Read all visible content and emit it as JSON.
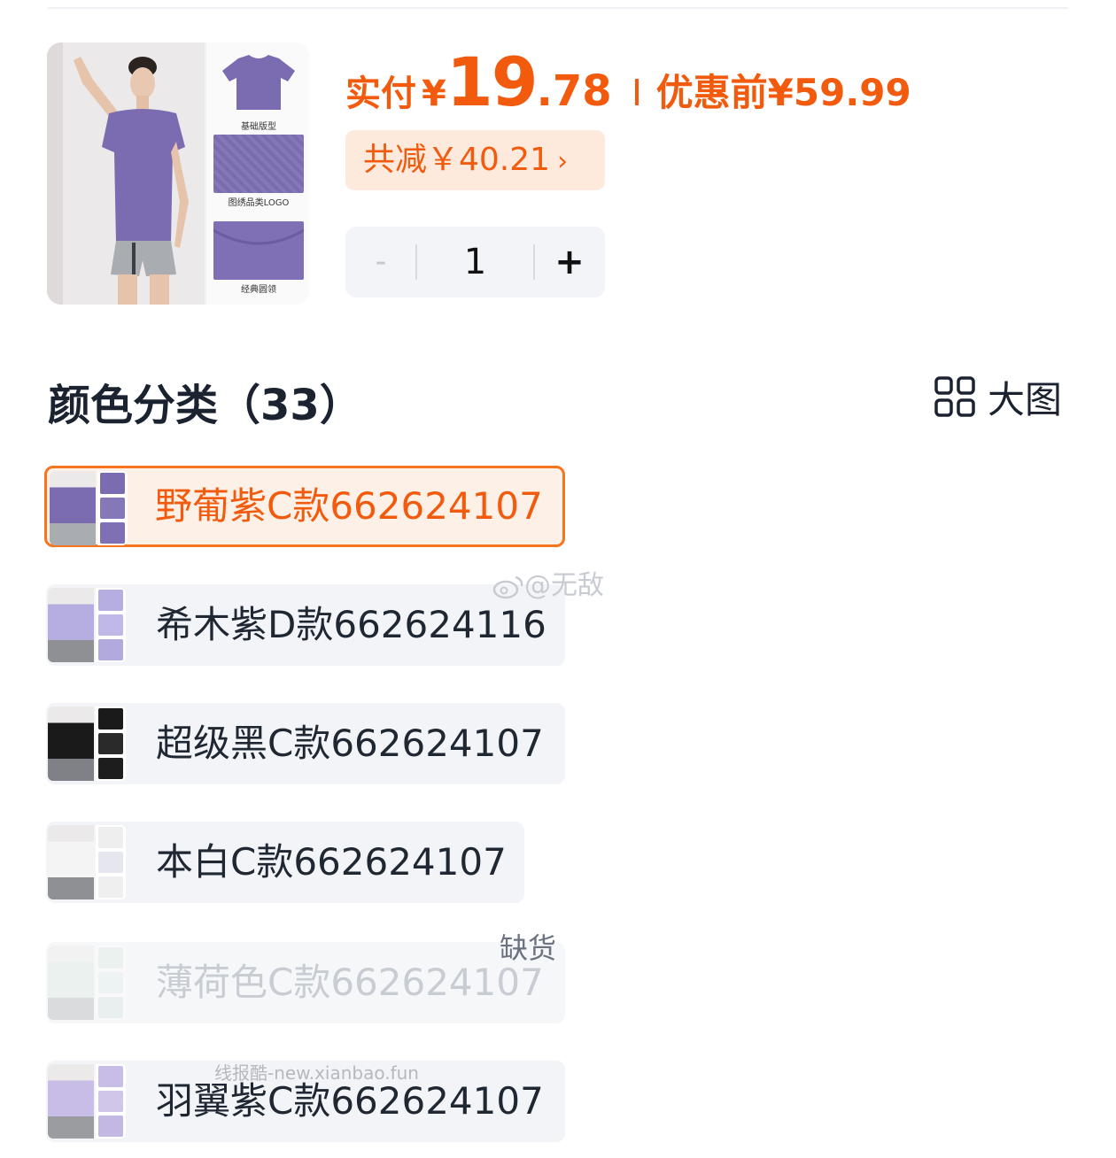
{
  "price": {
    "paid_label": "实付",
    "currency": "¥",
    "paid_integer": "19",
    "paid_decimal": ".78",
    "original_label": "优惠前",
    "original_price": "¥59.99",
    "accent_color": "#f25a0d"
  },
  "discount": {
    "text": "共减￥40.21",
    "chevron": "›"
  },
  "quantity": {
    "minus": "-",
    "value": "1",
    "plus": "+"
  },
  "product_thumb": {
    "captions": [
      "基础版型",
      "图绣品类LOGO",
      "经典圆领"
    ]
  },
  "section": {
    "title": "颜色分类（33）",
    "big_image_label": "大图",
    "big_image_icon": "grid-icon"
  },
  "variants": [
    {
      "label": "野葡紫C款662624107",
      "state": "selected",
      "color": "#7b6bb0"
    },
    {
      "label": "希木紫D款662624116",
      "state": "normal",
      "color": "#b6aee0"
    },
    {
      "label": "超级黑C款662624107",
      "state": "normal",
      "color": "#1a1a1a"
    },
    {
      "label": "本白C款662624107",
      "state": "normal",
      "color": "#eeeeee"
    },
    {
      "label": "薄荷色C款662624107",
      "state": "out_of_stock",
      "badge": "缺货",
      "color": "#d7e6df"
    },
    {
      "label": "羽翼紫C款662624107",
      "state": "normal",
      "color": "#c7bde6"
    }
  ],
  "watermarks": {
    "weibo": "@无敌",
    "site": "线报酷-new.xianbao.fun"
  }
}
